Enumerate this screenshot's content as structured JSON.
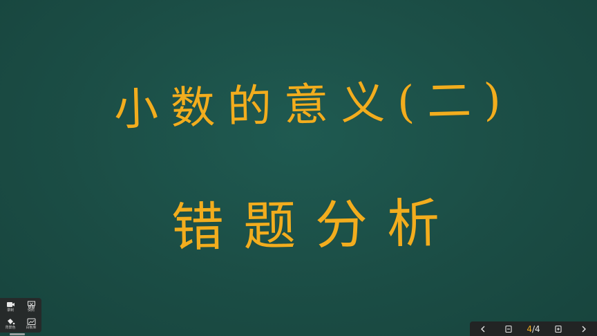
{
  "board": {
    "line1": "小数的意义(二)",
    "line2": "错题分析",
    "text_color": "#f2ad1e",
    "background_color": "#1b4d45"
  },
  "tool_panel": {
    "items": [
      {
        "label": "录制",
        "icon": "camera-icon"
      },
      {
        "label": "快照",
        "icon": "scissors-icon"
      },
      {
        "label": "背景色",
        "icon": "paint-bucket-icon"
      },
      {
        "label": "白板库",
        "icon": "image-icon"
      }
    ]
  },
  "pager": {
    "prev_icon": "chevron-left-icon",
    "remove_icon": "minus-page-icon",
    "current_page": "4",
    "total_pages": "4",
    "separator": "/",
    "add_icon": "plus-page-icon",
    "next_icon": "chevron-right-icon"
  }
}
